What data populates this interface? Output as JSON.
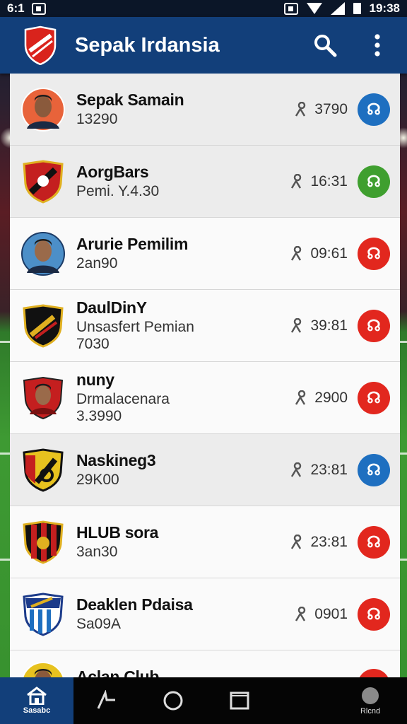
{
  "status_bar": {
    "time_left": "6:1",
    "time_right": "19:38"
  },
  "app_bar": {
    "title": "Sepak Irdansia",
    "logo_icon": "club-shield-logo",
    "search_icon": "search-icon",
    "menu_icon": "more-vertical-icon"
  },
  "rows": [
    {
      "name": "Sepak Samain",
      "sub": "13290",
      "sub2": "",
      "metric": "3790",
      "crest": "player-portrait",
      "action_color": "#1e6fc0",
      "action_glyph": "☊"
    },
    {
      "name": "AorgBars",
      "sub": "Pemi. Y.4.30",
      "sub2": "",
      "metric": "16:31",
      "crest": "club-crest-red",
      "action_color": "#3f9f2f",
      "action_glyph": "☊"
    },
    {
      "name": "Arurie Pemilim",
      "sub": "2an90",
      "sub2": "",
      "metric": "09:61",
      "crest": "player-portrait",
      "action_color": "#e2271e",
      "action_glyph": "☊"
    },
    {
      "name": "DaulDinY",
      "sub": "Unsasfert Pemian",
      "sub2": "7030",
      "metric": "39:81",
      "crest": "club-crest-black",
      "action_color": "#e2271e",
      "action_glyph": "☊"
    },
    {
      "name": "nuny",
      "sub": "Drmalacenara",
      "sub2": "3.3990",
      "metric": "2900",
      "crest": "player-portrait-red",
      "action_color": "#e2271e",
      "action_glyph": "☊"
    },
    {
      "name": "Naskineg3",
      "sub": "29K00",
      "sub2": "",
      "metric": "23:81",
      "crest": "club-crest-yellow",
      "action_color": "#1e6fc0",
      "action_glyph": "☊"
    },
    {
      "name": "HLUB sora",
      "sub": "3an30",
      "sub2": "",
      "metric": "23:81",
      "crest": "club-crest-redblack",
      "action_color": "#e2271e",
      "action_glyph": "☊"
    },
    {
      "name": "Deaklen Pdaisa",
      "sub": "Sa09A",
      "sub2": "",
      "metric": "0901",
      "crest": "club-crest-blue",
      "action_color": "#e2271e",
      "action_glyph": "☊"
    },
    {
      "name": "Aclan Club",
      "sub": "",
      "sub2": "",
      "metric": "",
      "crest": "player-portrait",
      "action_color": "#e2271e",
      "action_glyph": "☊"
    }
  ],
  "nav_bar": {
    "home_label": "Sasabc",
    "profile_label": "Rlcnd",
    "back_icon": "back-icon",
    "home_circle_icon": "home-circle-icon",
    "recents_icon": "recents-icon"
  },
  "colors": {
    "primary": "#123f7a",
    "blue": "#1e6fc0",
    "green": "#3f9f2f",
    "red": "#e2271e"
  }
}
